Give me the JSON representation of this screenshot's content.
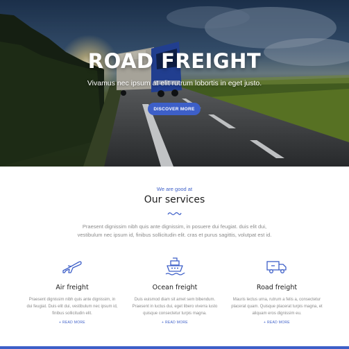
{
  "hero": {
    "title": "ROAD FREIGHT",
    "subtitle": "Vivamus nec ipsum at elit rutrum lobortis in eget justo.",
    "button_label": "DISCOVER MORE"
  },
  "services_section": {
    "eyebrow": "We are good at",
    "title": "Our services",
    "intro": "Praesent dignissim nibh quis ante dignissim, in posuere dui feugiat. duis elit dui, vestibulum nec ipsum id, finibus sollicitudin elit. cras et purus sagittis, volutpat est id.",
    "items": [
      {
        "icon": "airplane-icon",
        "name": "Air freight",
        "description": "Praesent dignissim nibh quis ante dignissim, in dui feugiat. Duis elit dui, vestibulum nec ipsum id, finibus sollicitudin elit.",
        "more_label": "+ READ MORE"
      },
      {
        "icon": "ship-icon",
        "name": "Ocean freight",
        "description": "Duis euismod diam sit amet sem bibendum. Praesent in luctus dui, eget libero viverra iusto quisque consectetur turpis magna.",
        "more_label": "+ READ MORE"
      },
      {
        "icon": "truck-icon",
        "name": "Road freight",
        "description": "Mauris lectus urna, rutrum a felis a, consectetur placerat quam. Quisque placerat turpis magna, et aliquam eros dignissim eu.",
        "more_label": "+ READ MORE"
      }
    ]
  },
  "colors": {
    "accent": "#3d5fc8",
    "heading": "#1c1c1c",
    "body_text": "#8a8a8a"
  }
}
